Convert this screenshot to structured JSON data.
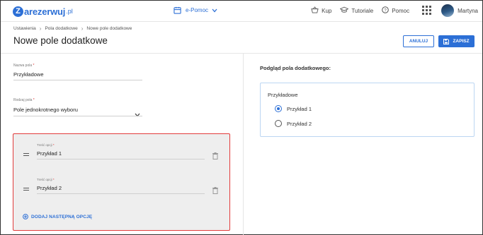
{
  "brand": {
    "letter": "Z",
    "name": "arezerwuj",
    "suffix": ".pl"
  },
  "topbar": {
    "module": "e-Pomoc",
    "links": {
      "buy": "Kup",
      "tutorials": "Tutoriale",
      "help": "Pomoc"
    },
    "user": "Martyna"
  },
  "breadcrumb": {
    "items": [
      "Ustawienia",
      "Pola dodatkowe",
      "Nowe pole dodatkowe"
    ]
  },
  "page": {
    "title": "Nowe pole dodatkowe"
  },
  "actions": {
    "cancel": "ANULUJ",
    "save": "ZAPISZ"
  },
  "form": {
    "name_label": "Nazwa pola",
    "name_value": "Przykładowe",
    "type_label": "Rodzaj pola",
    "type_value": "Pole jednokrotnego wyboru",
    "required_mark": "*",
    "options": [
      {
        "label": "Treść opcji",
        "value": "Przykład 1"
      },
      {
        "label": "Treść opcji",
        "value": "Przykład 2"
      }
    ],
    "add_option": "DODAJ NASTĘPNĄ OPCJĘ"
  },
  "preview": {
    "title": "Podgląd pola dodatkowego:",
    "field_name": "Przykładowe",
    "options": [
      {
        "label": "Przykład 1",
        "selected": true
      },
      {
        "label": "Przykład 2",
        "selected": false
      }
    ]
  },
  "colors": {
    "accent": "#2c6fd6",
    "highlight_border": "#e23b3b"
  }
}
